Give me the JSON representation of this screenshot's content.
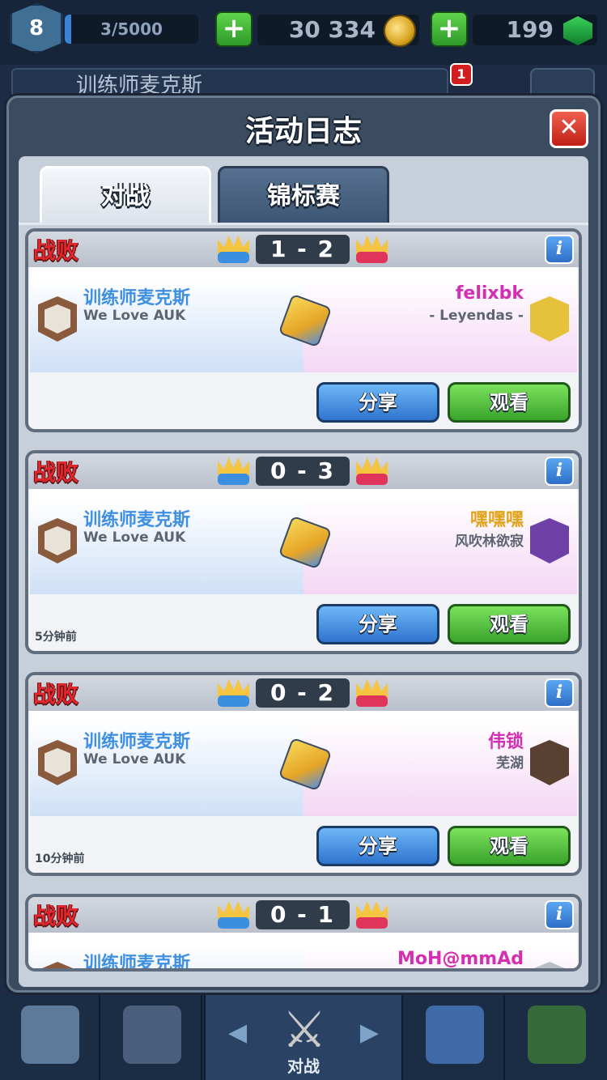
{
  "topbar": {
    "level": "8",
    "xp": "3/5000",
    "gold": "30 334",
    "gems": "199",
    "player_name": "训练师麦克斯",
    "notification_count": "1",
    "icons": {
      "gold": "coin-icon",
      "gems": "gem-icon",
      "add": "plus-icon"
    }
  },
  "modal": {
    "title": "活动日志",
    "close_icon": "close-icon",
    "tabs": [
      {
        "label": "对战",
        "active": true
      },
      {
        "label": "锦标赛",
        "active": false
      }
    ]
  },
  "battles": [
    {
      "result": "战败",
      "score": "1 - 2",
      "player": {
        "name": "训练师麦克斯",
        "clan": "We Love AUK"
      },
      "opponent": {
        "name": "felixbk",
        "clan": "- Leyendas -",
        "name_color": "#d42fb0"
      },
      "time": "",
      "share_label": "分享",
      "watch_label": "观看"
    },
    {
      "result": "战败",
      "score": "0 - 3",
      "player": {
        "name": "训练师麦克斯",
        "clan": "We Love AUK"
      },
      "opponent": {
        "name": "嘿嘿嘿",
        "clan": "风吹林欲寂",
        "name_color": "#e0a41c"
      },
      "time": "5分钟前",
      "share_label": "分享",
      "watch_label": "观看"
    },
    {
      "result": "战败",
      "score": "0 - 2",
      "player": {
        "name": "训练师麦克斯",
        "clan": "We Love AUK"
      },
      "opponent": {
        "name": "伟锁",
        "clan": "芜湖",
        "name_color": "#d42fb0"
      },
      "time": "10分钟前",
      "share_label": "分享",
      "watch_label": "观看"
    },
    {
      "result": "战败",
      "score": "0 - 1",
      "player": {
        "name": "训练师麦克斯"
      },
      "opponent": {
        "name": "MoH@mmAd",
        "name_color": "#d42fb0"
      }
    }
  ],
  "bottom_nav": {
    "battle_label": "对战"
  },
  "colors": {
    "loss_red": "#e3262b",
    "player_blue": "#3f8fe2",
    "share_blue": "#2f74cf",
    "watch_green": "#3aa42c"
  }
}
